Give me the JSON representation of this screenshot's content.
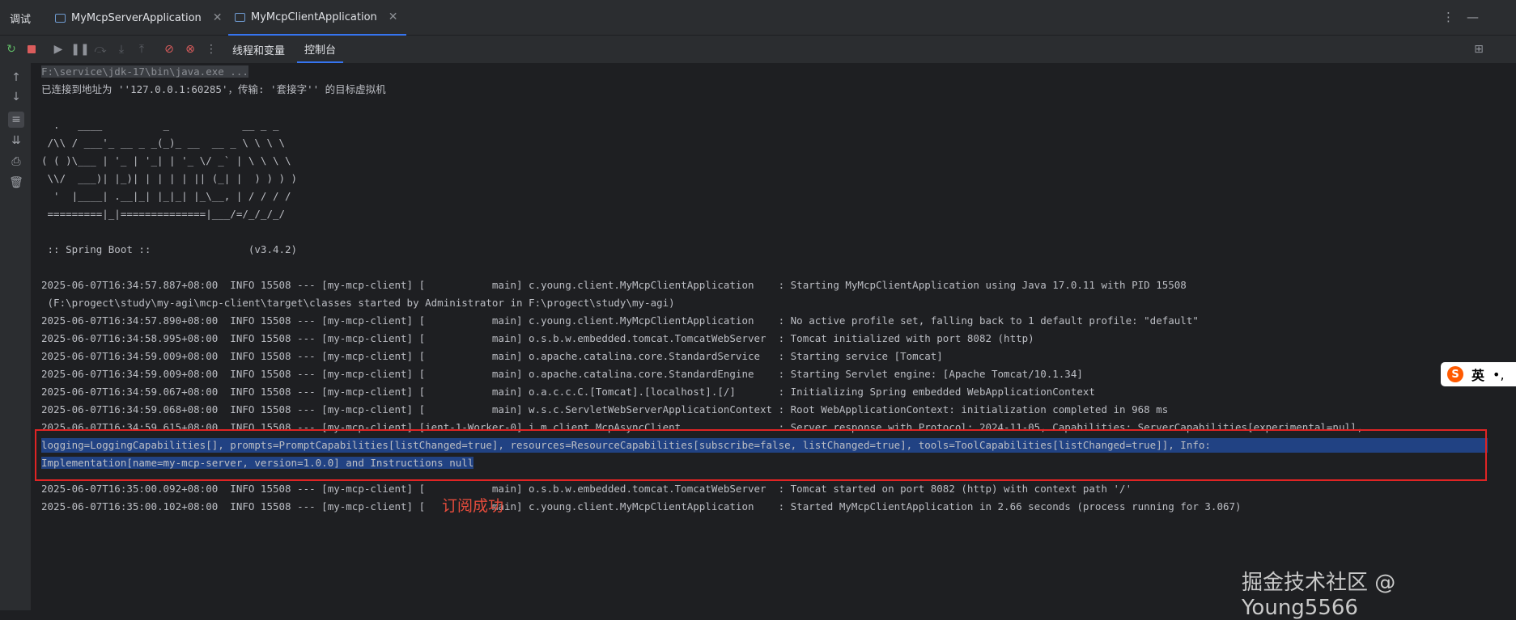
{
  "tabs": {
    "title": "调试",
    "items": [
      {
        "label": "MyMcpServerApplication",
        "active": false
      },
      {
        "label": "MyMcpClientApplication",
        "active": true
      }
    ]
  },
  "toolbar": {
    "tab_threads": "线程和变量",
    "tab_console": "控制台"
  },
  "console": {
    "lines": [
      "F:\\service\\jdk-17\\bin\\java.exe ...",
      "已连接到地址为 ''127.0.0.1:60285'，传输: '套接字'' 的目标虚拟机",
      "",
      "  .   ____          _            __ _ _",
      " /\\\\ / ___'_ __ _ _(_)_ __  __ _ \\ \\ \\ \\",
      "( ( )\\___ | '_ | '_| | '_ \\/ _` | \\ \\ \\ \\",
      " \\\\/  ___)| |_)| | | | | || (_| |  ) ) ) )",
      "  '  |____| .__|_| |_|_| |_\\__, | / / / /",
      " =========|_|==============|___/=/_/_/_/",
      "",
      " :: Spring Boot ::                (v3.4.2)",
      "",
      "2025-06-07T16:34:57.887+08:00  INFO 15508 --- [my-mcp-client] [           main] c.young.client.MyMcpClientApplication    : Starting MyMcpClientApplication using Java 17.0.11 with PID 15508",
      " (F:\\progect\\study\\my-agi\\mcp-client\\target\\classes started by Administrator in F:\\progect\\study\\my-agi)",
      "2025-06-07T16:34:57.890+08:00  INFO 15508 --- [my-mcp-client] [           main] c.young.client.MyMcpClientApplication    : No active profile set, falling back to 1 default profile: \"default\"",
      "2025-06-07T16:34:58.995+08:00  INFO 15508 --- [my-mcp-client] [           main] o.s.b.w.embedded.tomcat.TomcatWebServer  : Tomcat initialized with port 8082 (http)",
      "2025-06-07T16:34:59.009+08:00  INFO 15508 --- [my-mcp-client] [           main] o.apache.catalina.core.StandardService   : Starting service [Tomcat]",
      "2025-06-07T16:34:59.009+08:00  INFO 15508 --- [my-mcp-client] [           main] o.apache.catalina.core.StandardEngine    : Starting Servlet engine: [Apache Tomcat/10.1.34]",
      "2025-06-07T16:34:59.067+08:00  INFO 15508 --- [my-mcp-client] [           main] o.a.c.c.C.[Tomcat].[localhost].[/]       : Initializing Spring embedded WebApplicationContext",
      "2025-06-07T16:34:59.068+08:00  INFO 15508 --- [my-mcp-client] [           main] w.s.c.ServletWebServerApplicationContext : Root WebApplicationContext: initialization completed in 968 ms",
      "2025-06-07T16:34:59.615+08:00  INFO 15508 --- [my-mcp-client] [ient-1-Worker-0] i.m.client.McpAsyncClient                : Server response with Protocol: 2024-11-05, Capabilities: ServerCapabilities[experimental=null,",
      "logging=LoggingCapabilities[], prompts=PromptCapabilities[listChanged=true], resources=ResourceCapabilities[subscribe=false, listChanged=true], tools=ToolCapabilities[listChanged=true]], Info:",
      "Implementation[name=my-mcp-server, version=1.0.0] and Instructions null",
      "2025-06-07T16:35:00.092+08:00  INFO 15508 --- [my-mcp-client] [           main] o.s.b.w.embedded.tomcat.TomcatWebServer  : Tomcat started on port 8082 (http) with context path '/'",
      "2025-06-07T16:35:00.102+08:00  INFO 15508 --- [my-mcp-client] [           main] c.young.client.MyMcpClientApplication    : Started MyMcpClientApplication in 2.66 seconds (process running for 3.067)"
    ]
  },
  "annotation": "订阅成功",
  "ime": {
    "label": "英"
  },
  "watermark": "掘金技术社区 @ Young5566",
  "colors": {
    "accent": "#3574f0",
    "highlight": "#214283",
    "annotation_red": "#e02424"
  }
}
